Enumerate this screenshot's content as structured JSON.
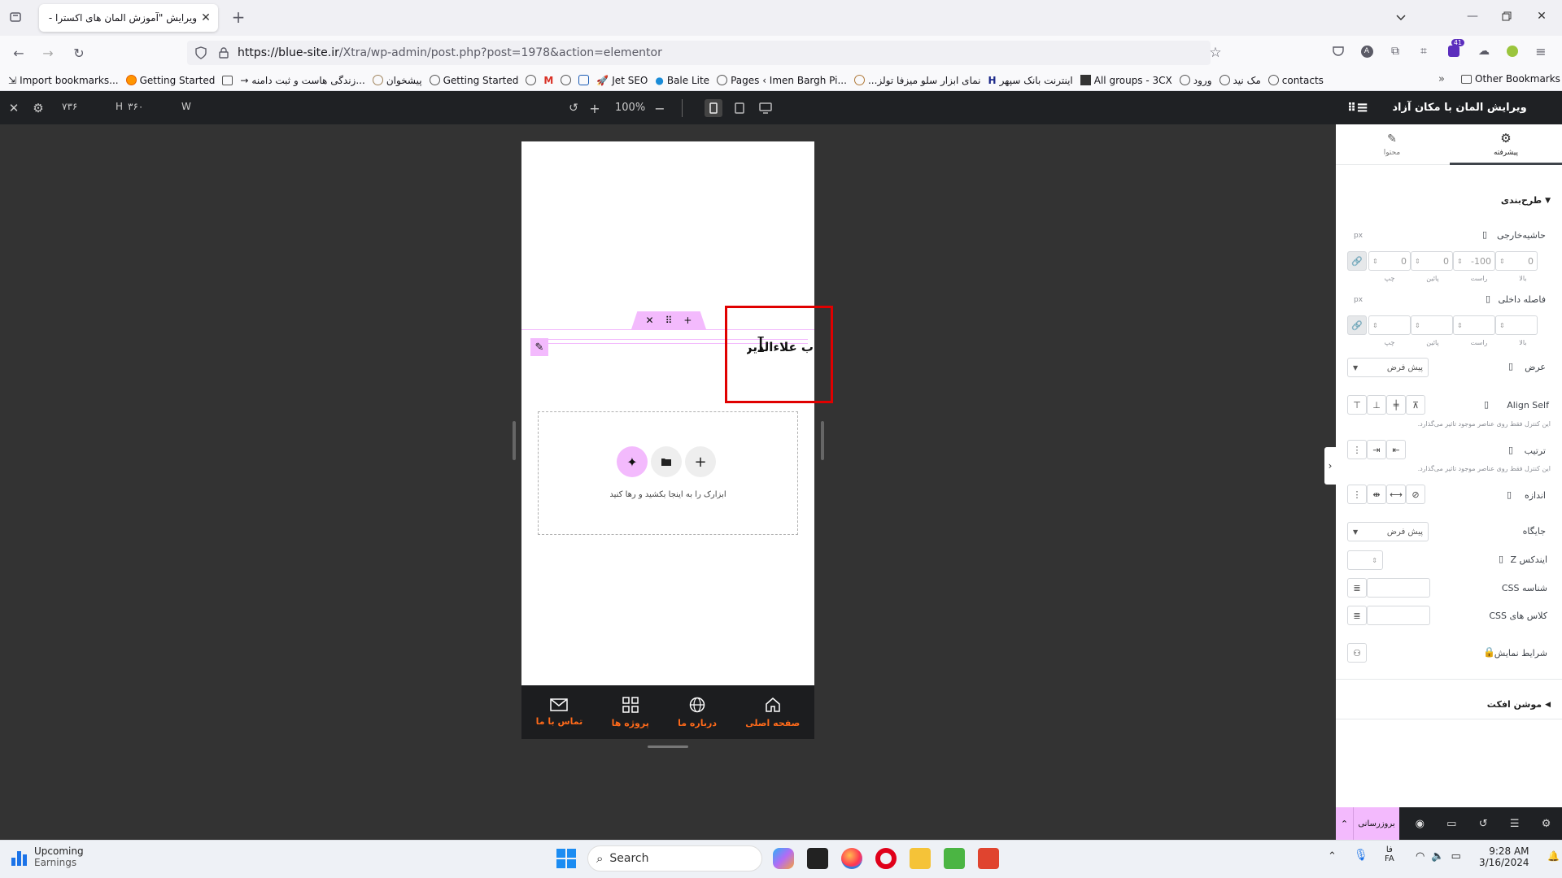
{
  "browser": {
    "tab_title": "ویرایش \"آموزش المان های اکسترا - م",
    "url_host": "https://blue-site.ir",
    "url_path": "/Xtra/wp-admin/post.php?post=1978&action=elementor",
    "extension_badge": "41",
    "bookmarks": [
      "Import bookmarks...",
      "Getting Started",
      "زندگی هاست و ثبت دامنه...",
      "پیشخوان",
      "Getting Started",
      "Jet SEO",
      "Bale Lite",
      "Pages ‹ Imen Bargh Pi...",
      "...نمای ابزار سلو میزفا تولز",
      "اینترنت بانک سپهر",
      "All groups - 3CX",
      "ورود",
      "مک نید",
      "contacts"
    ],
    "other_bookmarks": "Other Bookmarks"
  },
  "editor": {
    "height_value": "۷۳۶",
    "height_label": "H",
    "width_value": "۳۶۰",
    "width_label": "W",
    "zoom": "100%",
    "heading_text": "ب علاءالدین",
    "drop_text": "ابزارک را به اینجا بکشید و رها کنید",
    "bottom_nav": [
      {
        "label": "تماس با ما",
        "icon": "mail-icon"
      },
      {
        "label": "پروژه ها",
        "icon": "grid-icon"
      },
      {
        "label": "درباره ما",
        "icon": "globe-icon"
      },
      {
        "label": "صفحه اصلی",
        "icon": "home-icon"
      }
    ]
  },
  "panel": {
    "title": "ویرایش المان با مکان آزاد",
    "tab_advanced": "پیشرفته",
    "tab_content": "محتوا",
    "section_layout": "طرح‌بندی",
    "margin_label": "حاشیه‌خارجی",
    "margin_unit": "px",
    "margin_values": {
      "top": "0",
      "right": "-100",
      "bottom": "0",
      "left": "0"
    },
    "side_labels": {
      "top": "بالا",
      "right": "راست",
      "bottom": "پائین",
      "left": "چپ"
    },
    "padding_label": "فاصله داخلی",
    "padding_unit": "px",
    "width_label": "عرض",
    "width_value": "پیش فرض",
    "align_self_label": "Align Self",
    "align_note": "این کنترل فقط روی عناصر موجود تاثیر می‌گذارد.",
    "order_label": "ترتیب",
    "order_note": "این کنترل فقط روی عناصر موجود تاثیر می‌گذارد.",
    "size_label": "اندازه",
    "position_label": "جایگاه",
    "position_value": "پیش فرض",
    "zindex_label": "ایندکس Z",
    "css_id_label": "شناسه CSS",
    "css_class_label": "کلاس های CSS",
    "display_cond_label": "شرایط نمایش",
    "motion_label": "موشن افکت",
    "update_button": "بروزرسانی"
  },
  "taskbar": {
    "weather_title": "Upcoming",
    "weather_sub": "Earnings",
    "search_placeholder": "Search",
    "lang_top": "فا",
    "lang_bottom": "FA",
    "time": "9:28 AM",
    "date": "3/16/2024"
  },
  "colors": {
    "elementor_pink": "#f3bafd",
    "highlight_red": "#e00000",
    "nav_accent": "#ff6a1a",
    "editor_dark": "#1f2124"
  }
}
